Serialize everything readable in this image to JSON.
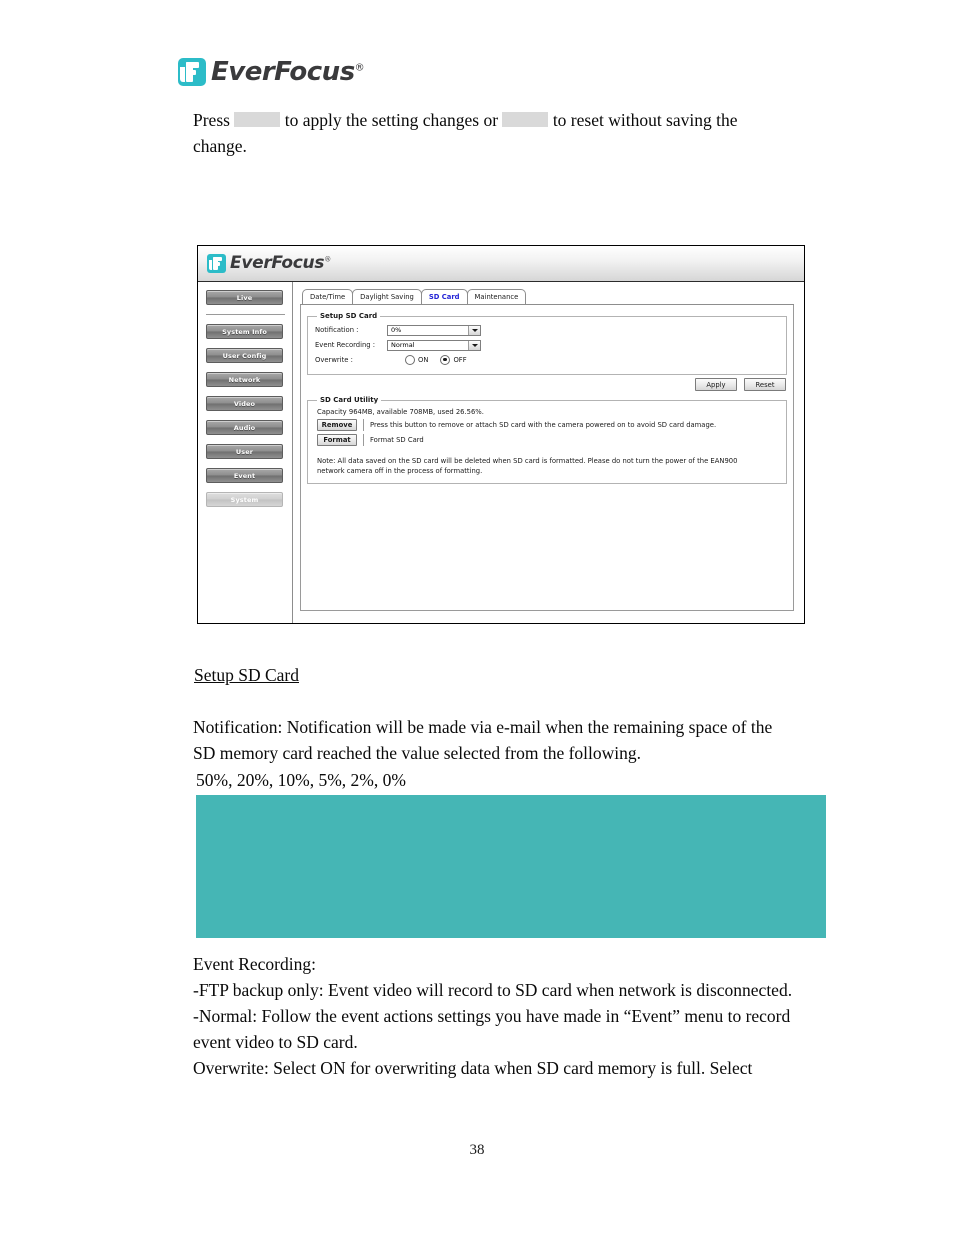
{
  "document": {
    "brand": {
      "name": "EverFocus",
      "registered_mark": "®",
      "logo_icon": "everfocus-logo-icon",
      "accent_color": "#2cbcc8"
    },
    "page_number": "38",
    "intro_paragraph": {
      "part1": "Press",
      "part2": "to apply the setting changes or",
      "part3": "to reset without saving the change."
    },
    "section_heading": "Setup SD Card",
    "notification_paragraph": "Notification: Notification will be made via e-mail when the remaining space of the SD memory card reached the value selected from the following.",
    "notification_values": "50%, 20%, 10%, 5%, 2%, 0%",
    "redacted_figure": {
      "label": "redacted-image-block",
      "color": "#45b6b5"
    },
    "event_paragraph": {
      "line1": "Event Recording:",
      "line2": "-FTP backup only: Event video will record to SD card when network is disconnected.",
      "line3": "-Normal: Follow the event actions settings you have made in “Event” menu to record event video to SD card.",
      "line4": "Overwrite: Select ON for overwriting data when SD card memory is full. Select"
    }
  },
  "figure": {
    "app_header": {
      "brand": "EverFocus",
      "registered_mark": "®"
    },
    "nav": {
      "primary": [
        {
          "label": "Live",
          "active": false
        }
      ],
      "items": [
        {
          "label": "System Info",
          "active": false
        },
        {
          "label": "User Config",
          "active": false
        },
        {
          "label": "Network",
          "active": false
        },
        {
          "label": "Video",
          "active": false
        },
        {
          "label": "Audio",
          "active": false
        },
        {
          "label": "User",
          "active": false
        },
        {
          "label": "Event",
          "active": false
        },
        {
          "label": "System",
          "active": true
        }
      ]
    },
    "tabs": [
      {
        "label": "Date/Time",
        "active": false
      },
      {
        "label": "Daylight Saving",
        "active": false
      },
      {
        "label": "SD Card",
        "active": true
      },
      {
        "label": "Maintenance",
        "active": false
      }
    ],
    "setup_group": {
      "legend": "Setup SD Card",
      "notification": {
        "label": "Notification :",
        "value": "0%"
      },
      "event_recording": {
        "label": "Event Recording :",
        "value": "Normal"
      },
      "overwrite": {
        "label": "Overwrite :",
        "on_label": "ON",
        "off_label": "OFF",
        "selected": "OFF"
      },
      "apply_label": "Apply",
      "reset_label": "Reset"
    },
    "utility_group": {
      "legend": "SD Card Utility",
      "capacity_line": "Capacity 964MB, available 708MB, used 26.56%.",
      "remove_button": "Remove",
      "remove_desc": "Press this button to remove or attach SD card with the camera powered on to avoid SD card damage.",
      "format_button": "Format",
      "format_desc": "Format SD Card",
      "note": "Note: All data saved on the SD card will be deleted when SD card is formatted. Please do not turn the power of the EAN900 network camera off in the process of formatting."
    }
  }
}
